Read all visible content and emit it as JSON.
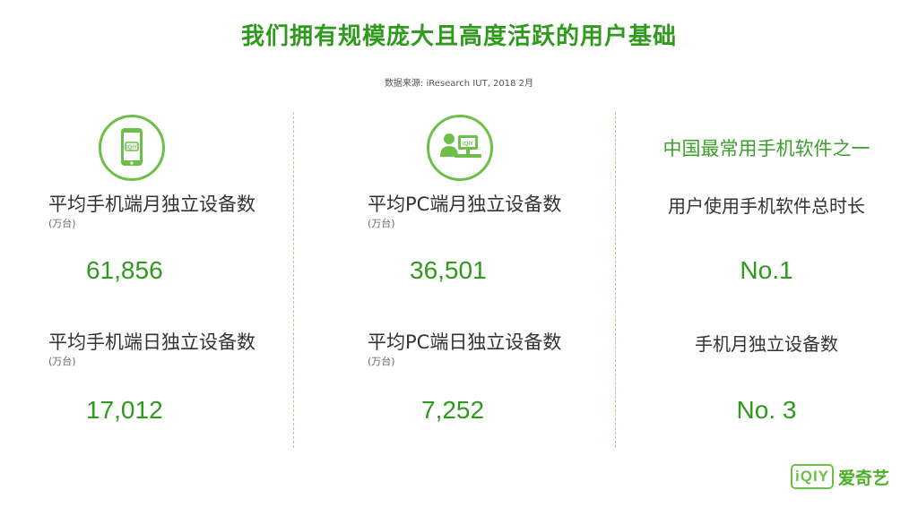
{
  "title": "我们拥有规模庞大且高度活跃的用户基础",
  "source": "数据来源: iResearch IUT, 2018 2月",
  "mobile": {
    "icon_name": "smartphone-icon",
    "monthly_label": "平均手机端月独立设备数",
    "monthly_unit": "(万台)",
    "monthly_value": "61,856",
    "daily_label": "平均手机端日独立设备数",
    "daily_unit": "(万台)",
    "daily_value": "17,012"
  },
  "pc": {
    "icon_name": "pc-user-icon",
    "monthly_label": "平均PC端月独立设备数",
    "monthly_unit": "(万台)",
    "monthly_value": "36,501",
    "daily_label": "平均PC端日独立设备数",
    "daily_unit": "(万台)",
    "daily_value": "7,252"
  },
  "ranking": {
    "tagline": "中国最常用手机软件之一",
    "metric1_label": "用户使用手机软件总时长",
    "metric1_rank": "No.1",
    "metric2_label": "手机月独立设备数",
    "metric2_rank": "No. 3"
  },
  "logo": {
    "mark": "iQIY",
    "name": "爱奇艺"
  },
  "colors": {
    "brand_green": "#2f9a1d",
    "icon_green": "#6cc04a"
  }
}
